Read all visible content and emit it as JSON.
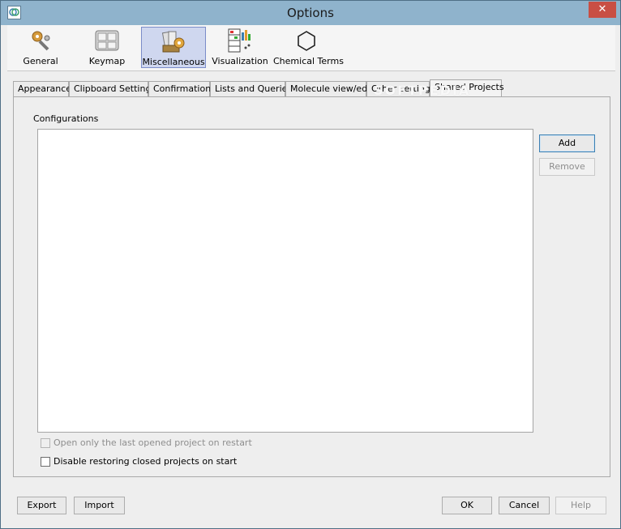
{
  "window": {
    "title": "Options",
    "close_glyph": "✕"
  },
  "toolbar": {
    "items": [
      {
        "label": "General",
        "icon": "wrench-gear-icon"
      },
      {
        "label": "Keymap",
        "icon": "keyboard-icon"
      },
      {
        "label": "Miscellaneous",
        "icon": "misc-tools-icon",
        "active": true
      },
      {
        "label": "Visualization",
        "icon": "grid-chart-icon"
      },
      {
        "label": "Chemical Terms",
        "icon": "benzene-ring-icon"
      }
    ]
  },
  "tabs": {
    "items": [
      {
        "label": "Appearance"
      },
      {
        "label": "Clipboard Settings"
      },
      {
        "label": "Confirmations"
      },
      {
        "label": "Lists and Queries"
      },
      {
        "label": "Molecule view/edit"
      },
      {
        "label": "Other settings"
      },
      {
        "label": "Shared Projects",
        "active": true
      }
    ]
  },
  "panel": {
    "configurations_label": "Configurations",
    "add_label": "Add",
    "remove_label": "Remove",
    "checkbox_open_last": {
      "label": "Open only the last opened project on restart",
      "checked": false,
      "enabled": false
    },
    "checkbox_disable_restore": {
      "label": "Disable restoring closed projects on start",
      "checked": false,
      "enabled": true
    }
  },
  "footer": {
    "export_label": "Export",
    "import_label": "Import",
    "ok_label": "OK",
    "cancel_label": "Cancel",
    "help_label": "Help"
  },
  "watermark": "SOFTPEDIA",
  "colors": {
    "titlebar": "#8fb3cc",
    "active_tool": "#cfd7ef",
    "close": "#c84f44"
  }
}
